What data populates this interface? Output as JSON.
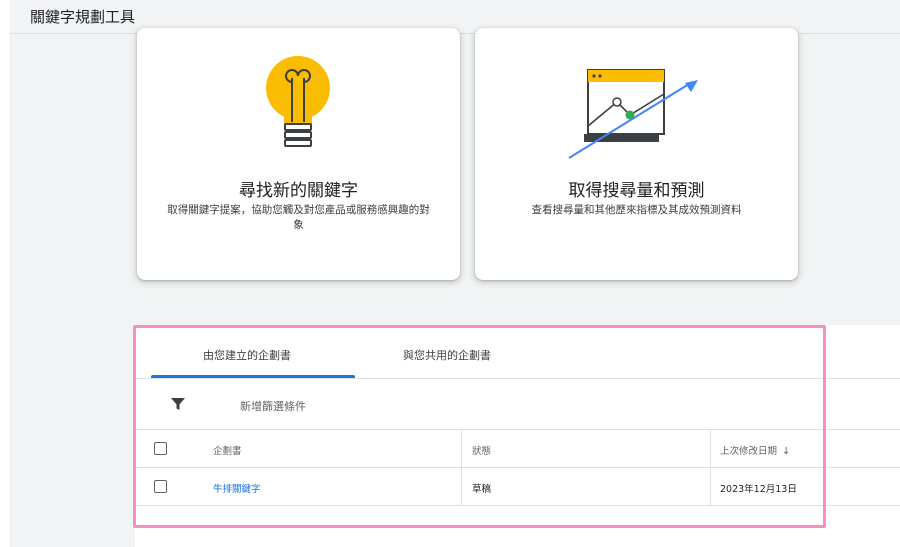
{
  "header": {
    "title": "關鍵字規劃工具"
  },
  "cards": [
    {
      "title": "尋找新的關鍵字",
      "description": "取得關鍵字提案，協助您觸及對您產品或服務感興趣的對象",
      "icon": "lightbulb-icon"
    },
    {
      "title": "取得搜尋量和預測",
      "description": "查看搜尋量和其他歷來指標及其成效預測資料",
      "icon": "trend-chart-icon"
    }
  ],
  "tabs": [
    {
      "label": "由您建立的企劃書",
      "selected": true
    },
    {
      "label": "與您共用的企劃書",
      "selected": false
    }
  ],
  "filter": {
    "label": "新增篩選條件",
    "icon": "filter-icon"
  },
  "table": {
    "columns": [
      "企劃書",
      "狀態",
      "上次修改日期"
    ],
    "sort_indicator": "↓",
    "rows": [
      {
        "name": "牛排關鍵字",
        "status": "草稿",
        "modified": "2023年12月13日"
      }
    ]
  },
  "colors": {
    "accent": "#1a73e8",
    "bulb": "#fbbc04",
    "highlight_border": "#f48fc7",
    "growth_dot": "#34a853"
  }
}
